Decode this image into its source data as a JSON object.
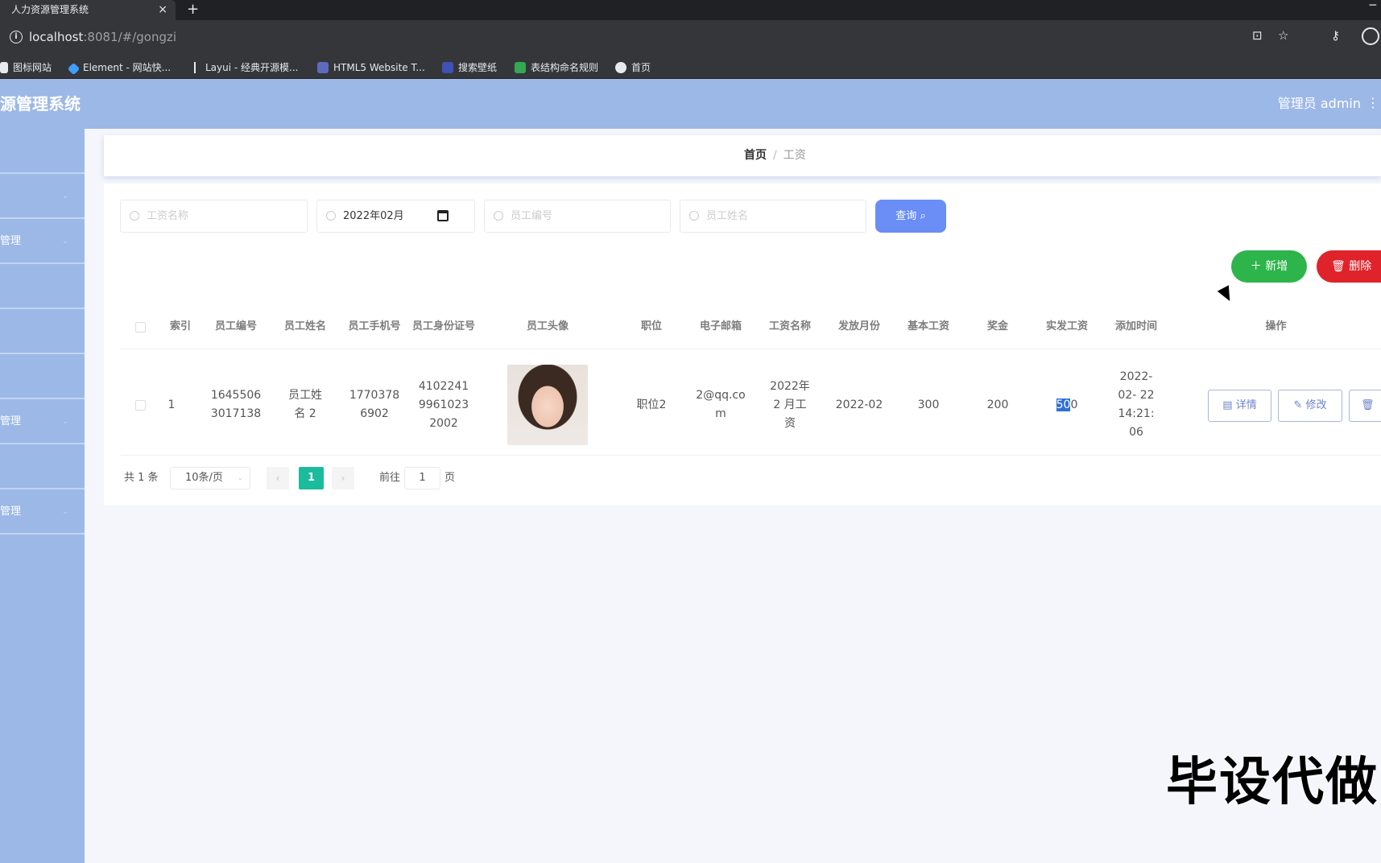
{
  "browser": {
    "tab_title": "人力资源管理系统",
    "tab_close": "×",
    "new_tab": "+",
    "url_host": "localhost",
    "url_rest": ":8081/#/gongzi",
    "bookmarks": [
      "图标网站",
      "Element - 网站快...",
      "Layui - 经典开源模...",
      "HTML5 Website T...",
      "搜索壁纸",
      "表结构命名规则",
      "首页"
    ]
  },
  "header": {
    "title": "源管理系统",
    "user": "管理员 admin"
  },
  "sidebar": {
    "items": [
      "",
      "",
      "管理",
      "",
      "",
      "",
      "管理",
      "",
      "管理"
    ]
  },
  "breadcrumb": {
    "home": "首页",
    "separator": "/",
    "current": "工资"
  },
  "search": {
    "salary_name_placeholder": "工资名称",
    "month_value": "2022年02月",
    "emp_no_placeholder": "员工编号",
    "emp_name_placeholder": "员工姓名",
    "query_label": "查询"
  },
  "actions": {
    "add_label": "新增",
    "delete_label": "删除"
  },
  "table": {
    "headers": [
      "索引",
      "员工编号",
      "员工姓名",
      "员工手机号",
      "员工身份证号",
      "员工头像",
      "职位",
      "电子邮箱",
      "工资名称",
      "发放月份",
      "基本工资",
      "奖金",
      "实发工资",
      "添加时间",
      "操作"
    ],
    "rows": [
      {
        "index": "1",
        "emp_no": "1645506 3017138",
        "emp_name": "员工姓名 2",
        "phone": "1770378 6902",
        "id_card": "4102241 9961023 2002",
        "position": "职位2",
        "email": "2@qq.co m",
        "salary_name": "2022年2 月工资",
        "month": "2022-02",
        "base_salary": "300",
        "bonus": "200",
        "actual_salary_sel": "50",
        "actual_salary_rest": "0",
        "added_time": "2022-02- 22 14:21: 06"
      }
    ],
    "op_detail": "详情",
    "op_edit": "修改"
  },
  "pagination": {
    "total": "共 1 条",
    "page_size": "10条/页",
    "current_page": "1",
    "goto_prefix": "前往",
    "goto_value": "1",
    "goto_suffix": "页"
  },
  "watermark": "毕设代做",
  "colors": {
    "header_bg": "#9cb8e6",
    "query_btn": "#6a8ef5",
    "add_btn": "#2db44a",
    "delete_btn": "#e0222a",
    "page_active": "#1abc9c"
  }
}
